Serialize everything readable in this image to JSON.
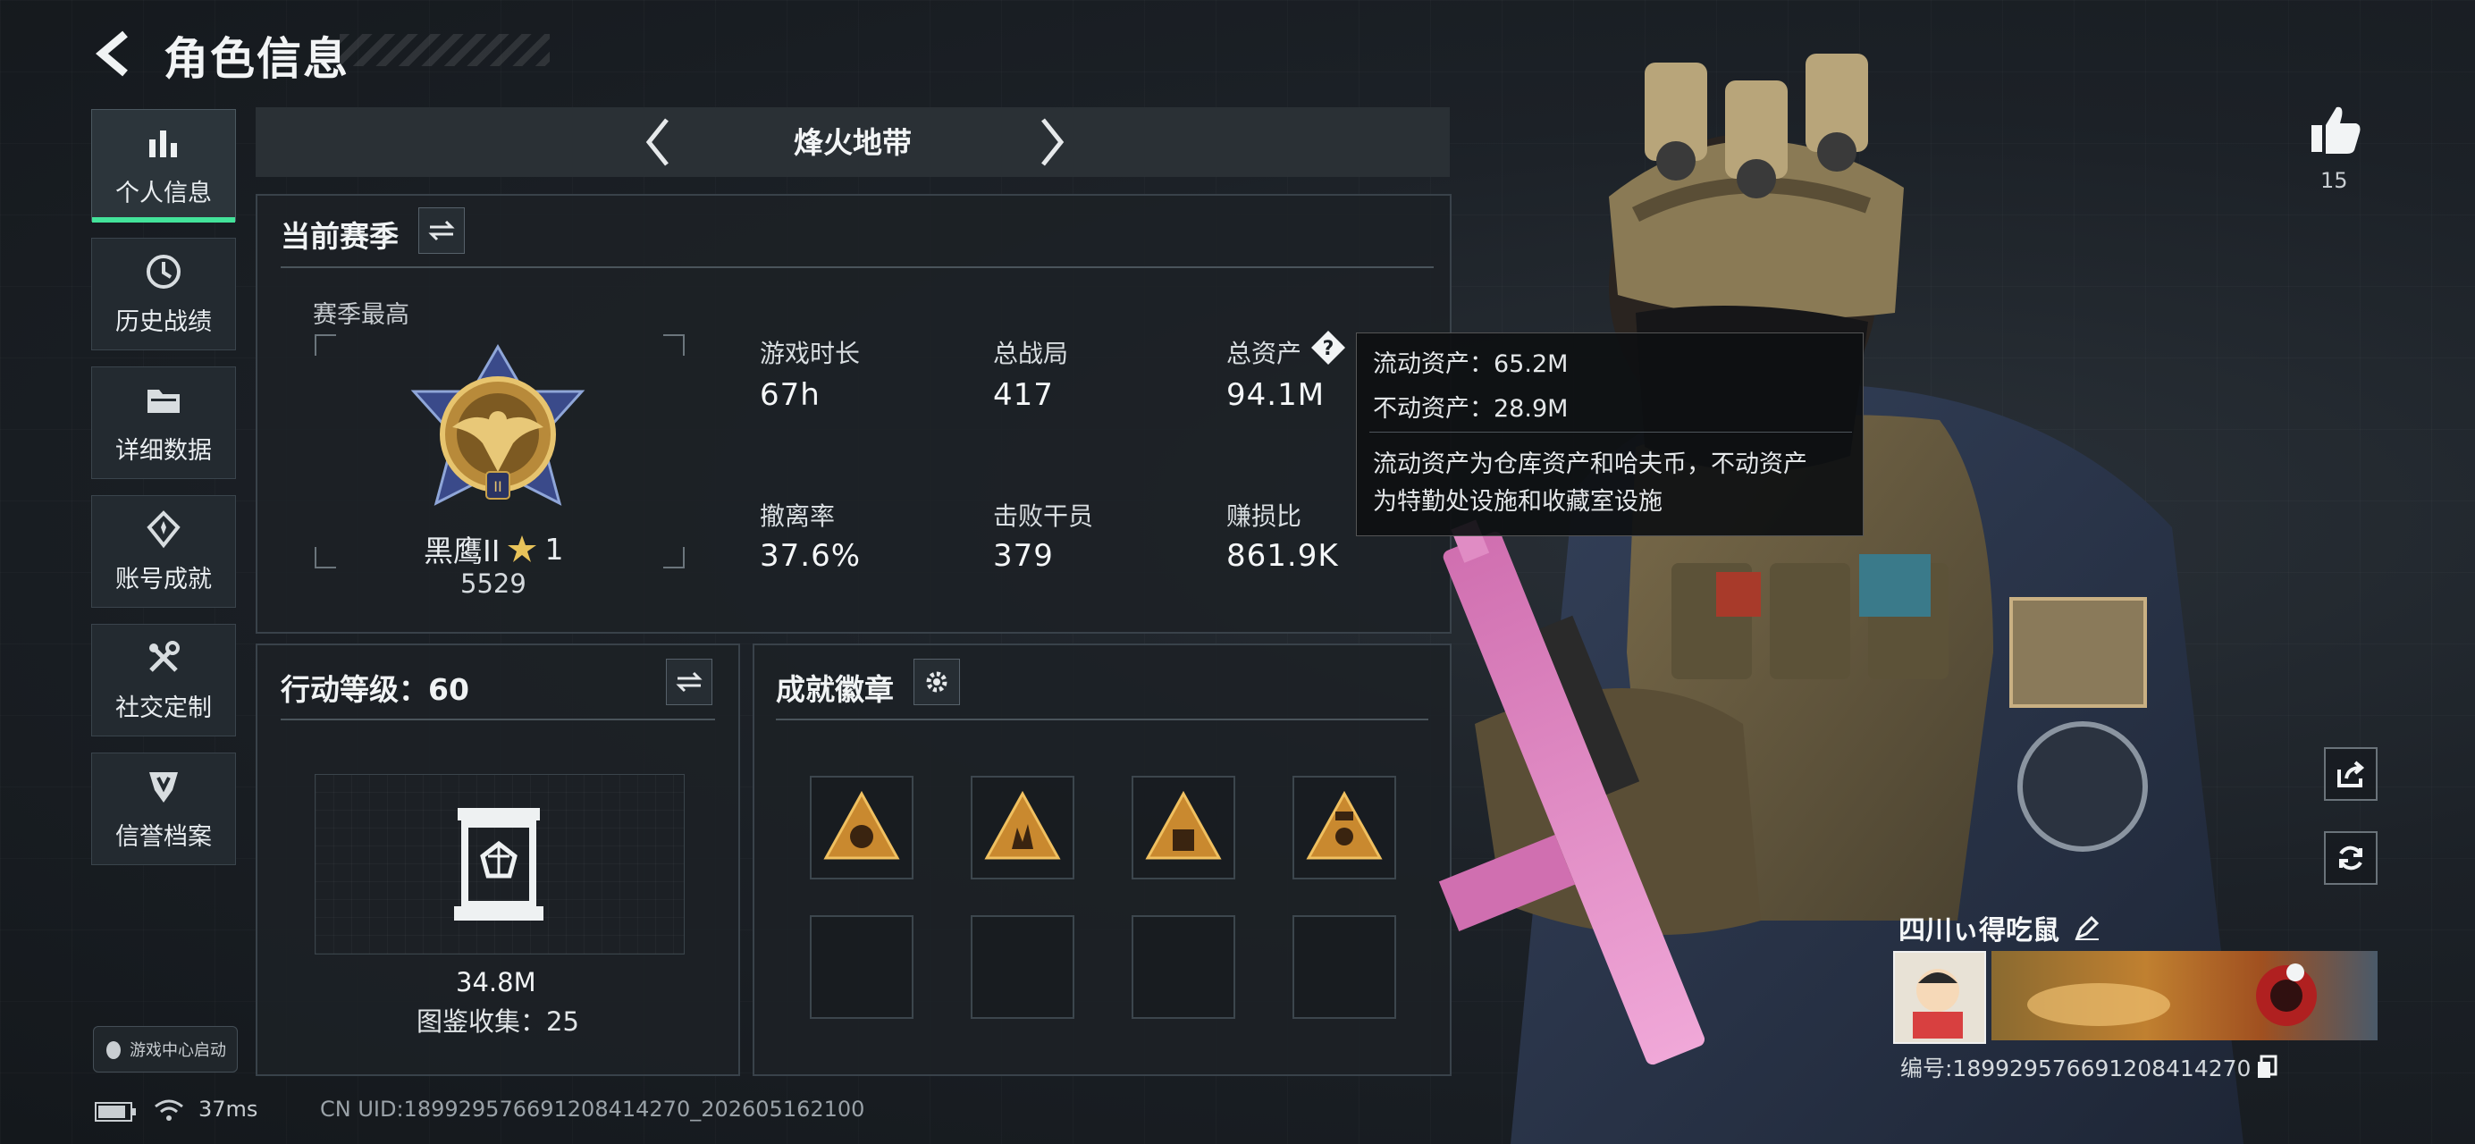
{
  "header": {
    "title": "角色信息"
  },
  "sidebar": {
    "items": [
      {
        "label": "个人信息",
        "icon": "bar-chart-icon",
        "active": true
      },
      {
        "label": "历史战绩",
        "icon": "history-icon",
        "active": false
      },
      {
        "label": "详细数据",
        "icon": "folder-icon",
        "active": false
      },
      {
        "label": "账号成就",
        "icon": "medal-icon",
        "active": false
      },
      {
        "label": "社交定制",
        "icon": "tools-icon",
        "active": false
      },
      {
        "label": "信誉档案",
        "icon": "shield-icon",
        "active": false
      }
    ],
    "launch_label": "游戏中心启动"
  },
  "mode": {
    "label": "烽火地带"
  },
  "season": {
    "title": "当前赛季",
    "best_label": "赛季最高",
    "rank_name": "黑鹰II",
    "rank_stars": "1",
    "rank_score": "5529",
    "stats": [
      {
        "label": "游戏时长",
        "value": "67h"
      },
      {
        "label": "总战局",
        "value": "417"
      },
      {
        "label": "总资产",
        "value": "94.1M"
      },
      {
        "label": "撤离率",
        "value": "37.6%"
      },
      {
        "label": "击败干员",
        "value": "379"
      },
      {
        "label": "赚损比",
        "value": "861.9K"
      }
    ]
  },
  "tooltip": {
    "liquid": "流动资产：65.2M",
    "fixed": "不动资产：28.9M",
    "desc1": "流动资产为仓库资产和哈夫币，不动资产",
    "desc2": "为特勤处设施和收藏室设施"
  },
  "action_level": {
    "title": "行动等级：60",
    "value": "34.8M",
    "collection": "图鉴收集：25"
  },
  "achievements": {
    "title": "成就徽章"
  },
  "profile": {
    "likes": "15",
    "name": "四川ぃ得吃鼠",
    "id_text": "编号:18992957669120841427​0"
  },
  "footer": {
    "ping": "37ms",
    "uid": "CN UID:18992957669120841427​0_202605162100"
  },
  "colors": {
    "accent": "#43e39a",
    "panel_border": "#39424a",
    "gold": "#c9a24a"
  }
}
